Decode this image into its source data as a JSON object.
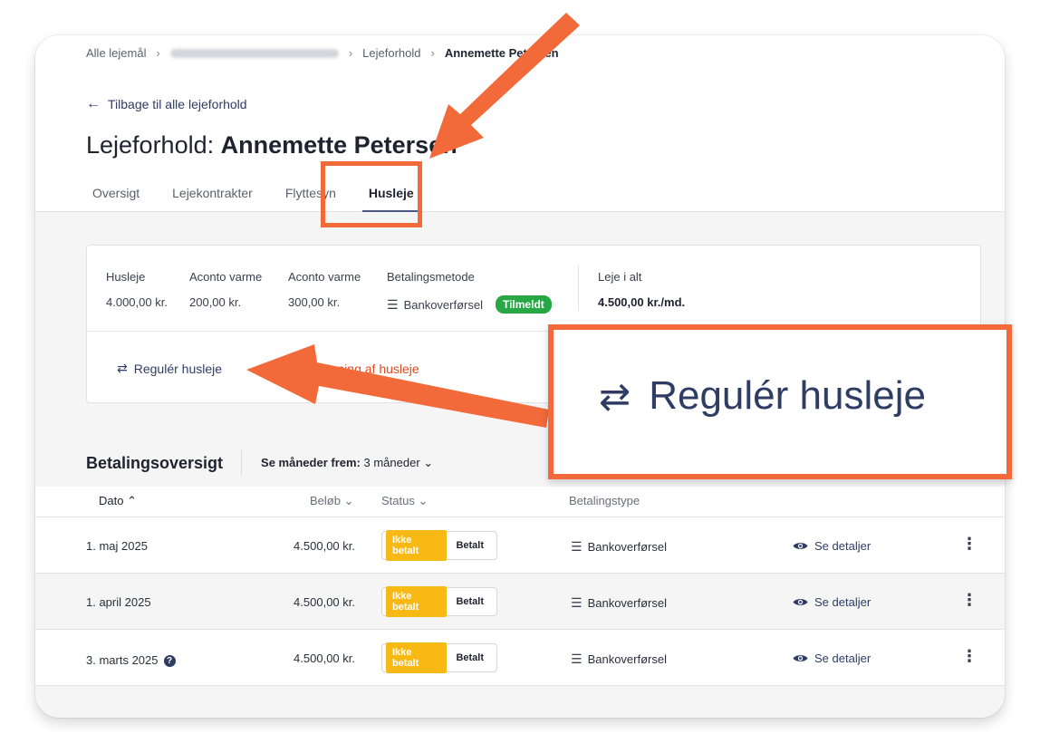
{
  "breadcrumb": {
    "items": [
      "Alle lejemål",
      "Lejeforhold"
    ],
    "current": "Annemette Petersen"
  },
  "back_link": "Tilbage til alle lejeforhold",
  "title": {
    "prefix": "Lejeforhold: ",
    "name": "Annemette Petersen"
  },
  "tabs": [
    {
      "label": "Oversigt"
    },
    {
      "label": "Lejekontrakter"
    },
    {
      "label": "Flyttesyn"
    },
    {
      "label": "Husleje"
    }
  ],
  "summary": {
    "husleje": {
      "label": "Husleje",
      "value": "4.000,00 kr."
    },
    "aconto1": {
      "label": "Aconto varme",
      "value": "200,00 kr."
    },
    "aconto2": {
      "label": "Aconto varme",
      "value": "300,00 kr."
    },
    "payment_method": {
      "label": "Betalingsmetode",
      "value": "Bankoverførsel",
      "badge": "Tilmeldt"
    },
    "total": {
      "label": "Leje i alt",
      "value": "4.500,00 kr./md."
    }
  },
  "actions": {
    "adjust": "Regulér husleje",
    "stop": "Stop opkrævning af husleje"
  },
  "payments": {
    "heading": "Betalingsoversigt",
    "months_label": "Se måneder frem:",
    "months_value": "3 måneder",
    "columns": {
      "date": "Dato",
      "amount": "Beløb",
      "status": "Status",
      "type": "Betalingstype"
    },
    "status_unpaid": "Ikke betalt",
    "status_paid": "Betalt",
    "details_label": "Se detaljer",
    "rows": [
      {
        "date": "1. maj 2025",
        "amount": "4.500,00 kr.",
        "type": "Bankoverførsel"
      },
      {
        "date": "1. april 2025",
        "amount": "4.500,00 kr.",
        "type": "Bankoverførsel"
      },
      {
        "date": "3. marts 2025",
        "amount": "4.500,00 kr.",
        "type": "Bankoverførsel"
      }
    ]
  },
  "zoom_callout": {
    "text": "Regulér husleje"
  },
  "colors": {
    "accent": "#2f3d64",
    "annotation": "#f26a3a",
    "badge_green": "#27a844",
    "unpaid_yellow": "#f9b914",
    "stop_red": "#e04a1f"
  }
}
